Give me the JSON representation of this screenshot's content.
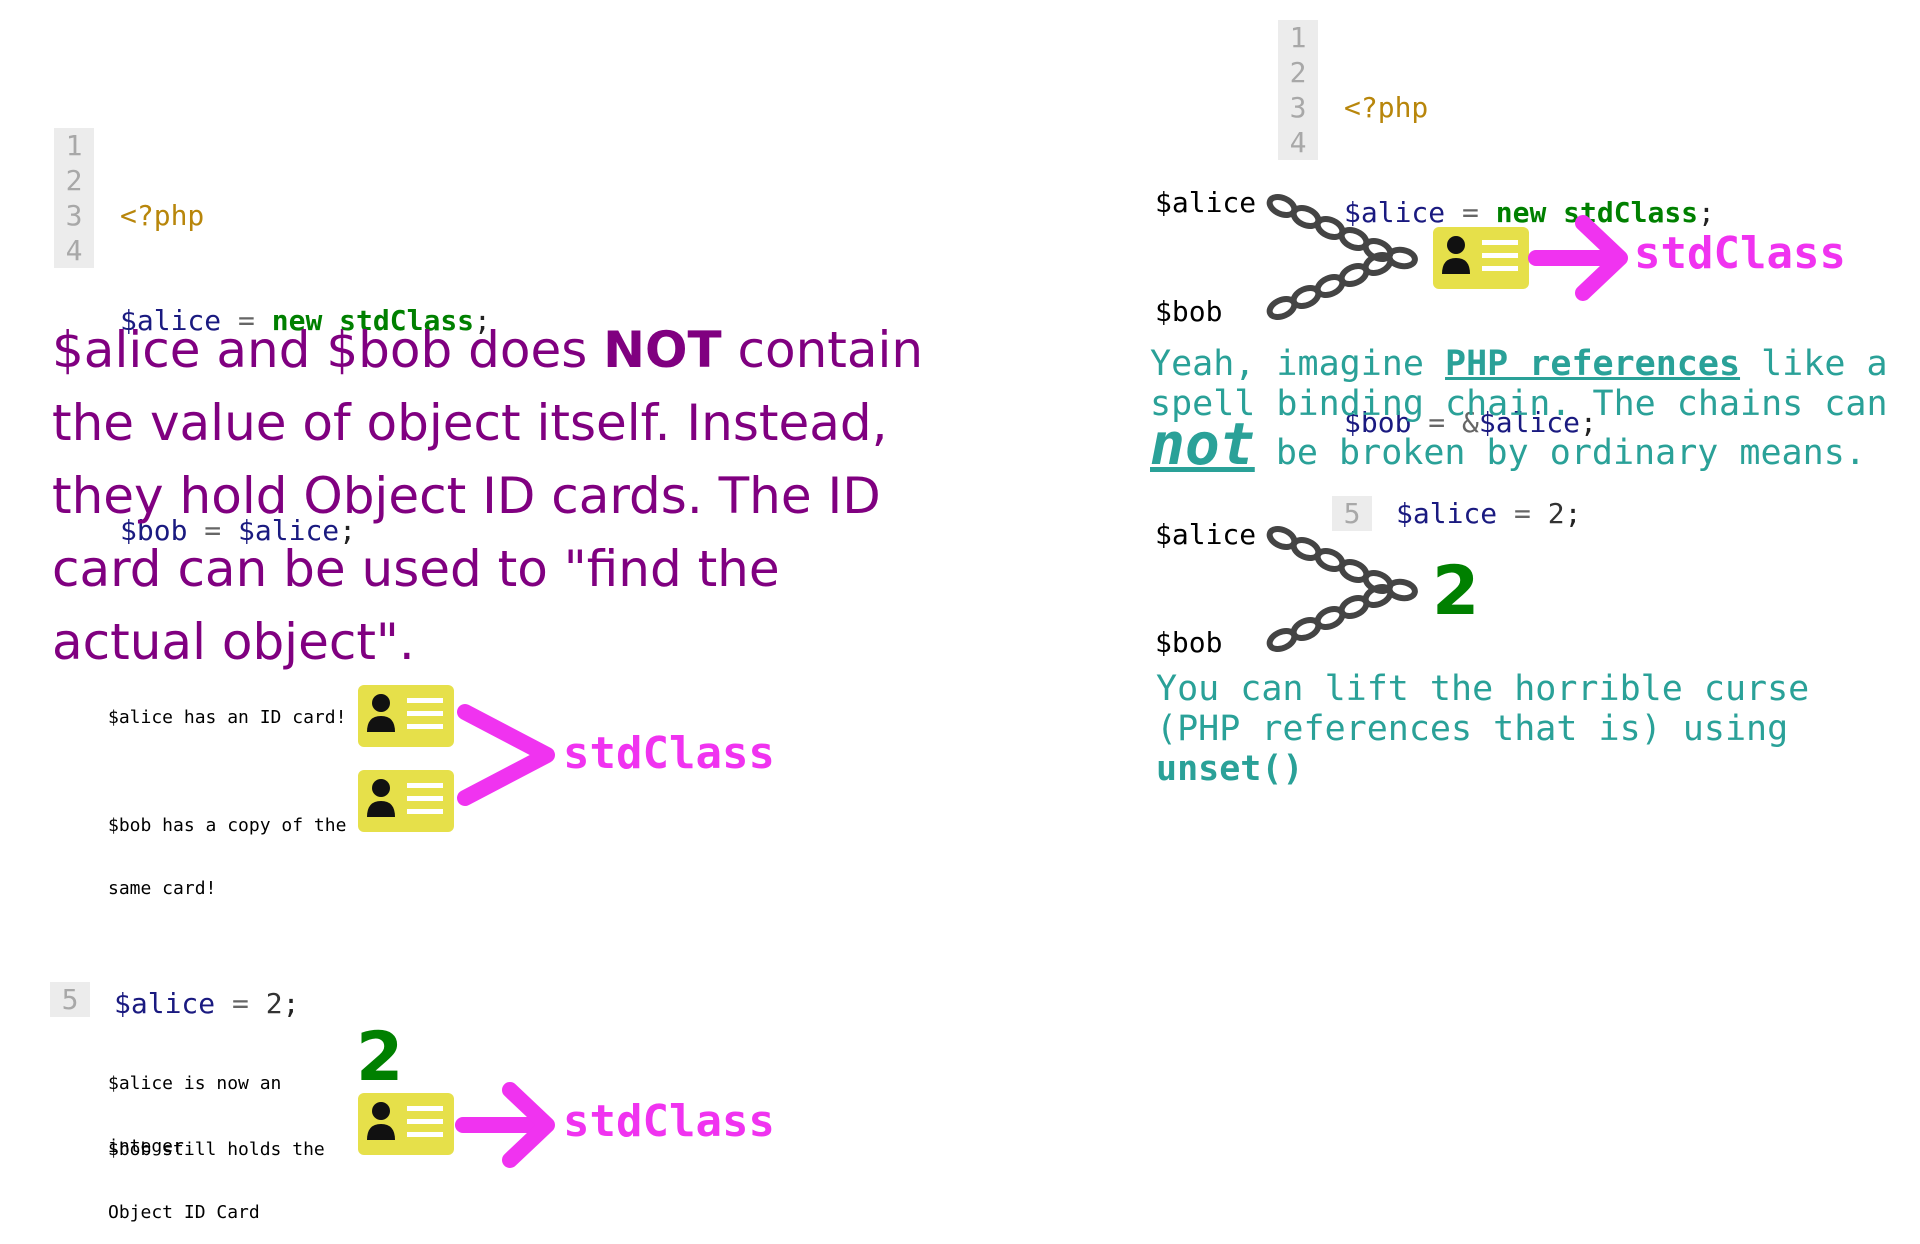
{
  "left_code": {
    "lines": [
      "1",
      "2",
      "3",
      "4"
    ],
    "php_open": "<?php",
    "alice_var": "$alice",
    "equals": "=",
    "new_kw": "new",
    "class_name": "stdClass",
    "semicolon": ";",
    "bob_var": "$bob",
    "bob_rhs": "$alice"
  },
  "explanation": {
    "part1": "$alice and $bob does ",
    "bold": "NOT",
    "part2": " contain the value of object itself.  Instead, they hold Object ID cards. The ID card can be used to \"find the actual object\"."
  },
  "copy_diagram": {
    "alice_label": "$alice has an ID card!",
    "bob_label_line1": "$bob has a copy of the",
    "bob_label_line2": "same card!",
    "target": "stdClass"
  },
  "left_assign": {
    "line_no": "5",
    "var": "$alice",
    "equals": "=",
    "value": "2",
    "semicolon": ";"
  },
  "assign_diagram": {
    "alice_line1": "$alice is now an",
    "alice_line2": "integer",
    "bob_line1": "$bob still holds the",
    "bob_line2": "Object ID Card",
    "value": "2",
    "target": "stdClass"
  },
  "right_code": {
    "lines": [
      "1",
      "2",
      "3",
      "4"
    ],
    "php_open": "<?php",
    "alice_var": "$alice",
    "equals": "=",
    "new_kw": "new",
    "class_name": "stdClass",
    "semicolon": ";",
    "bob_var": "$bob",
    "ampersand": "&",
    "bob_rhs": "$alice"
  },
  "ref_diagram": {
    "alice": "$alice",
    "bob": "$bob",
    "target": "stdClass"
  },
  "ref_text": {
    "part1": "Yeah, imagine ",
    "link": "PHP references",
    "part2": " like a spell binding chain. The chains can",
    "big": "not",
    "part3": " be broken by ordinary means."
  },
  "right_assign": {
    "line_no": "5",
    "var": "$alice",
    "equals": "=",
    "value": "2",
    "semicolon": ";"
  },
  "ref_assign_diagram": {
    "alice": "$alice",
    "bob": "$bob",
    "value": "2"
  },
  "unset_text": {
    "part1": "You can lift the horrible curse (PHP references that is) using",
    "fn": "unset()"
  },
  "colors": {
    "purple": "#800080",
    "magenta": "#f033f0",
    "green": "#008000",
    "teal": "#2aa198",
    "card_yellow": "#e6e04a"
  }
}
